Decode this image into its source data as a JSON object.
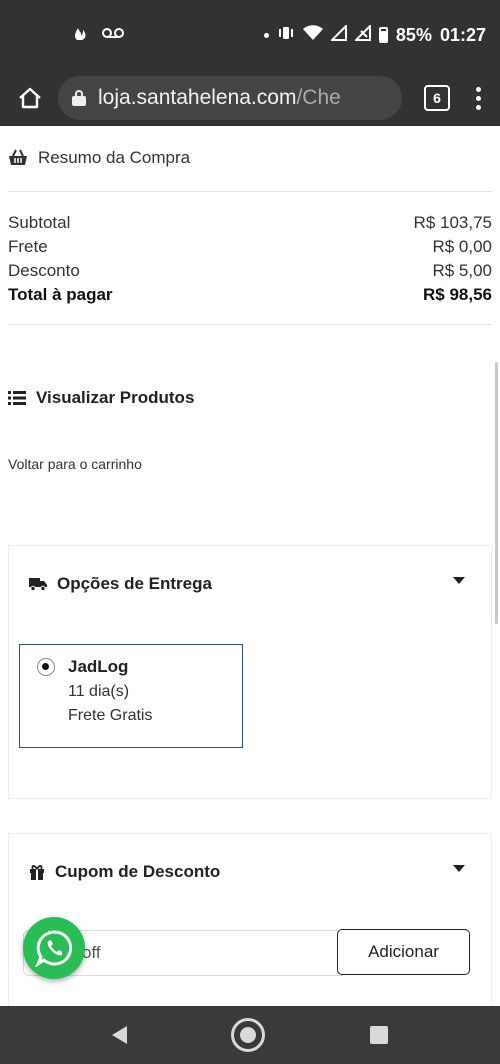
{
  "status_bar": {
    "battery": "85%",
    "time": "01:27",
    "icons": [
      "flame-leaf-icon",
      "voicemail-icon",
      "notification-dot-icon",
      "vibrate-icon",
      "wifi-icon",
      "signal-icon",
      "no-signal-icon",
      "battery-icon"
    ]
  },
  "browser": {
    "url_host": "loja.santahelena.com",
    "url_path": "/Che",
    "tabs_count": "6"
  },
  "resumo": {
    "title": "Resumo da Compra",
    "rows": [
      {
        "label": "Subtotal",
        "value": "R$ 103,75"
      },
      {
        "label": "Frete",
        "value": "R$ 0,00"
      },
      {
        "label": "Desconto",
        "value": "R$ 5,00"
      }
    ],
    "total_label": "Total à pagar",
    "total_value": "R$ 98,56"
  },
  "visualizar_label": "Visualizar Produtos",
  "voltar_label": "Voltar para o carrinho",
  "entrega": {
    "title": "Opções de Entrega",
    "option": {
      "name": "JadLog",
      "days": "11 dia(s)",
      "price": "Frete Gratis",
      "selected": true
    }
  },
  "cupom": {
    "title": "Cupom de Desconto",
    "input_value": "off",
    "button_label": "Adicionar"
  },
  "colors": {
    "status_bar": "#323232",
    "selected_border": "#2f4e7a",
    "whatsapp": "#2bbd55"
  }
}
